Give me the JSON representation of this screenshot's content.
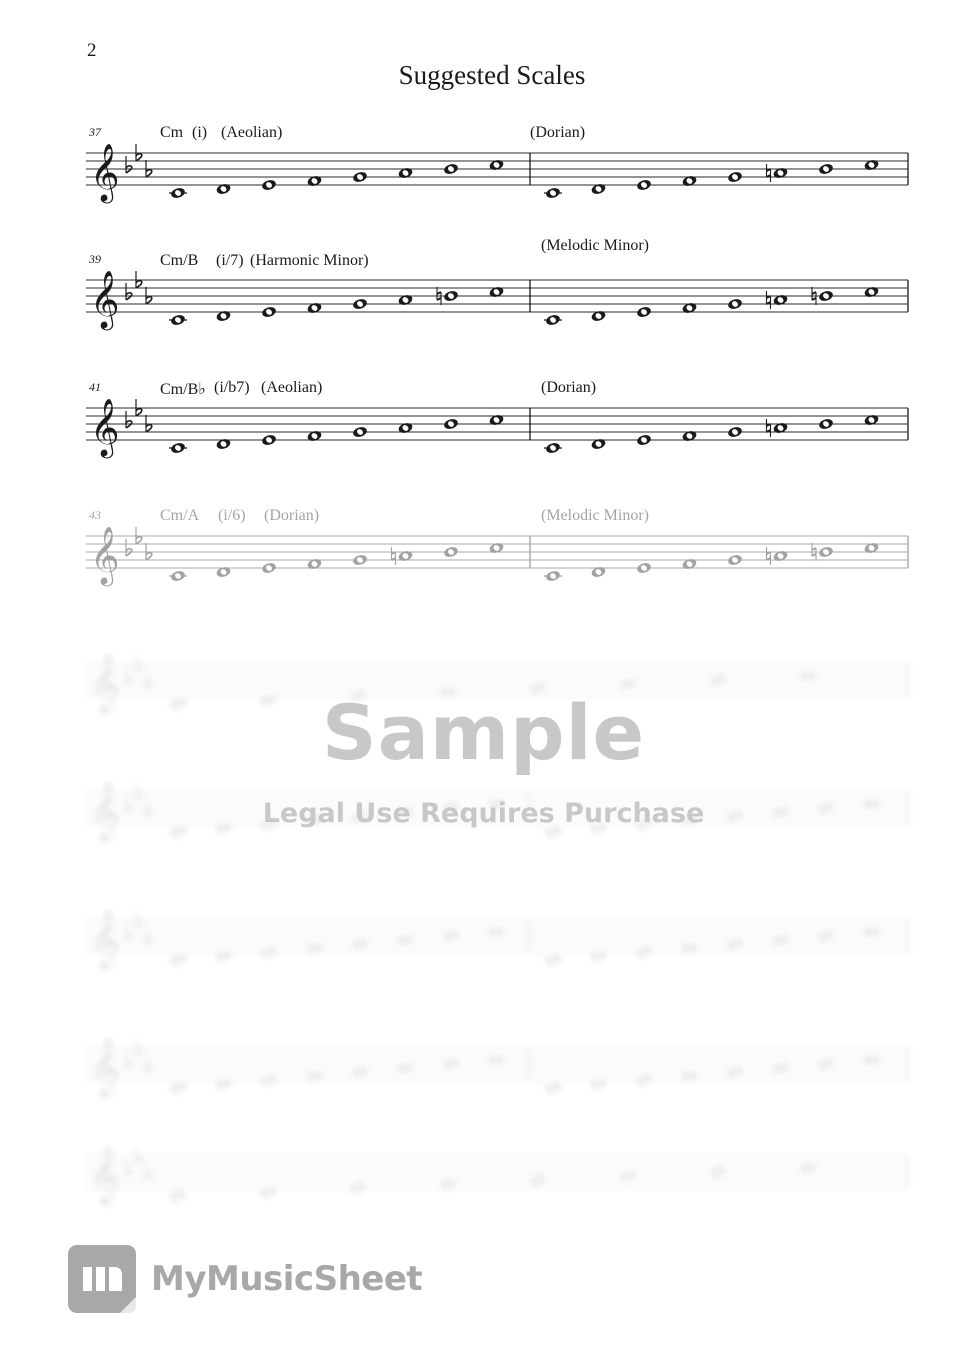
{
  "page": {
    "number": "2",
    "title": "Suggested Scales"
  },
  "systems": [
    {
      "measure": "37",
      "state": "clear",
      "left_label": {
        "chord": "Cm",
        "roman": "(i)",
        "scale": "(Aeolian)"
      },
      "right_label": {
        "scale": "(Dorian)"
      },
      "left_notes": [
        {
          "step": 0
        },
        {
          "step": 1
        },
        {
          "step": 2
        },
        {
          "step": 3
        },
        {
          "step": 4
        },
        {
          "step": 5
        },
        {
          "step": 6
        },
        {
          "step": 7
        }
      ],
      "right_notes": [
        {
          "step": 0
        },
        {
          "step": 1
        },
        {
          "step": 2
        },
        {
          "step": 3
        },
        {
          "step": 4
        },
        {
          "step": 5,
          "acc": "natural"
        },
        {
          "step": 6
        },
        {
          "step": 7
        }
      ]
    },
    {
      "measure": "39",
      "state": "clear",
      "left_label": {
        "chord": "Cm/B",
        "roman": "(i/7)",
        "scale": "(Harmonic Minor)"
      },
      "right_label": {
        "scale": "(Melodic Minor)"
      },
      "left_notes": [
        {
          "step": 0
        },
        {
          "step": 1
        },
        {
          "step": 2
        },
        {
          "step": 3
        },
        {
          "step": 4
        },
        {
          "step": 5
        },
        {
          "step": 6,
          "acc": "natural"
        },
        {
          "step": 7
        }
      ],
      "right_notes": [
        {
          "step": 0
        },
        {
          "step": 1
        },
        {
          "step": 2
        },
        {
          "step": 3
        },
        {
          "step": 4
        },
        {
          "step": 5,
          "acc": "natural"
        },
        {
          "step": 6,
          "acc": "natural"
        },
        {
          "step": 7
        }
      ]
    },
    {
      "measure": "41",
      "state": "clear",
      "left_label": {
        "chord": "Cm/B♭",
        "roman": "(i/b7)",
        "scale": "(Aeolian)"
      },
      "right_label": {
        "scale": "(Dorian)"
      },
      "left_notes": [
        {
          "step": 0
        },
        {
          "step": 1
        },
        {
          "step": 2
        },
        {
          "step": 3
        },
        {
          "step": 4
        },
        {
          "step": 5
        },
        {
          "step": 6
        },
        {
          "step": 7
        }
      ],
      "right_notes": [
        {
          "step": 0
        },
        {
          "step": 1
        },
        {
          "step": 2
        },
        {
          "step": 3
        },
        {
          "step": 4
        },
        {
          "step": 5,
          "acc": "natural"
        },
        {
          "step": 6
        },
        {
          "step": 7
        }
      ]
    },
    {
      "measure": "43",
      "state": "faded",
      "left_label": {
        "chord": "Cm/A",
        "roman": "(i/6)",
        "scale": "(Dorian)"
      },
      "right_label": {
        "scale": "(Melodic Minor)"
      },
      "left_notes": [
        {
          "step": 0
        },
        {
          "step": 1
        },
        {
          "step": 2
        },
        {
          "step": 3
        },
        {
          "step": 4
        },
        {
          "step": 5,
          "acc": "natural"
        },
        {
          "step": 6
        },
        {
          "step": 7
        }
      ],
      "right_notes": [
        {
          "step": 0
        },
        {
          "step": 1
        },
        {
          "step": 2
        },
        {
          "step": 3
        },
        {
          "step": 4
        },
        {
          "step": 5,
          "acc": "natural"
        },
        {
          "step": 6,
          "acc": "natural"
        },
        {
          "step": 7
        }
      ]
    },
    {
      "state": "blurred",
      "single": true,
      "notes_count": 8
    },
    {
      "state": "blurred",
      "notes_count": 8
    },
    {
      "state": "blurred",
      "notes_count": 8
    },
    {
      "state": "blurred",
      "notes_count": 8
    },
    {
      "state": "blurred",
      "single": true,
      "notes_count": 8
    }
  ],
  "watermark": {
    "main": "Sample",
    "sub": "Legal Use Requires Purchase"
  },
  "brand": {
    "name": "MyMusicSheet"
  },
  "colors": {
    "ink": "#1a1a1a",
    "watermark": "#c8c8c8",
    "brand": "#a8a8a8"
  }
}
